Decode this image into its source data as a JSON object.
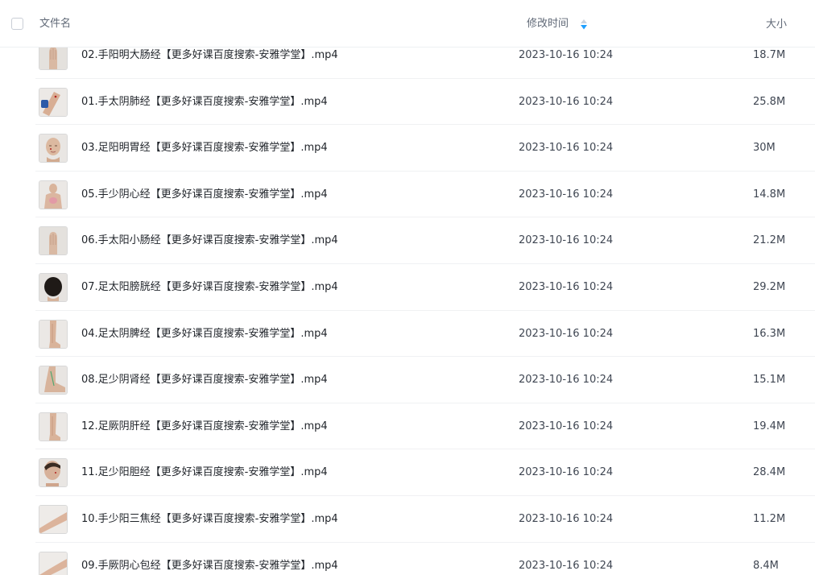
{
  "header": {
    "name_label": "文件名",
    "time_label": "修改时间",
    "size_label": "大小",
    "sort_icon": "sort-desc-icon",
    "sort_color_active": "#1e9fff",
    "sort_color_inactive": "#c9d3e0"
  },
  "files": [
    {
      "name": "02.手阳明大肠经【更多好课百度搜索-安雅学堂】.mp4",
      "time": "2023-10-16 10:24",
      "size": "18.7M",
      "thumb": "hand-thumb"
    },
    {
      "name": "01.手太阴肺经【更多好课百度搜索-安雅学堂】.mp4",
      "time": "2023-10-16 10:24",
      "size": "25.8M",
      "thumb": "arm-thumb"
    },
    {
      "name": "03.足阳明胃经【更多好课百度搜索-安雅学堂】.mp4",
      "time": "2023-10-16 10:24",
      "size": "30M",
      "thumb": "face-thumb"
    },
    {
      "name": "05.手少阴心经【更多好课百度搜索-安雅学堂】.mp4",
      "time": "2023-10-16 10:24",
      "size": "14.8M",
      "thumb": "torso-thumb"
    },
    {
      "name": "06.手太阳小肠经【更多好课百度搜索-安雅学堂】.mp4",
      "time": "2023-10-16 10:24",
      "size": "21.2M",
      "thumb": "hand-thumb"
    },
    {
      "name": "07.足太阳膀胱经【更多好课百度搜索-安雅学堂】.mp4",
      "time": "2023-10-16 10:24",
      "size": "29.2M",
      "thumb": "head-back-thumb"
    },
    {
      "name": "04.足太阴脾经【更多好课百度搜索-安雅学堂】.mp4",
      "time": "2023-10-16 10:24",
      "size": "16.3M",
      "thumb": "leg-thumb"
    },
    {
      "name": "08.足少阴肾经【更多好课百度搜索-安雅学堂】.mp4",
      "time": "2023-10-16 10:24",
      "size": "15.1M",
      "thumb": "foot-thumb"
    },
    {
      "name": "12.足厥阴肝经【更多好课百度搜索-安雅学堂】.mp4",
      "time": "2023-10-16 10:24",
      "size": "19.4M",
      "thumb": "leg-thumb"
    },
    {
      "name": "11.足少阳胆经【更多好课百度搜索-安雅学堂】.mp4",
      "time": "2023-10-16 10:24",
      "size": "28.4M",
      "thumb": "head-side-thumb"
    },
    {
      "name": "10.手少阳三焦经【更多好课百度搜索-安雅学堂】.mp4",
      "time": "2023-10-16 10:24",
      "size": "11.2M",
      "thumb": "forearm-thumb"
    },
    {
      "name": "09.手厥阴心包经【更多好课百度搜索-安雅学堂】.mp4",
      "time": "2023-10-16 10:24",
      "size": "8.4M",
      "thumb": "forearm-thumb"
    }
  ]
}
